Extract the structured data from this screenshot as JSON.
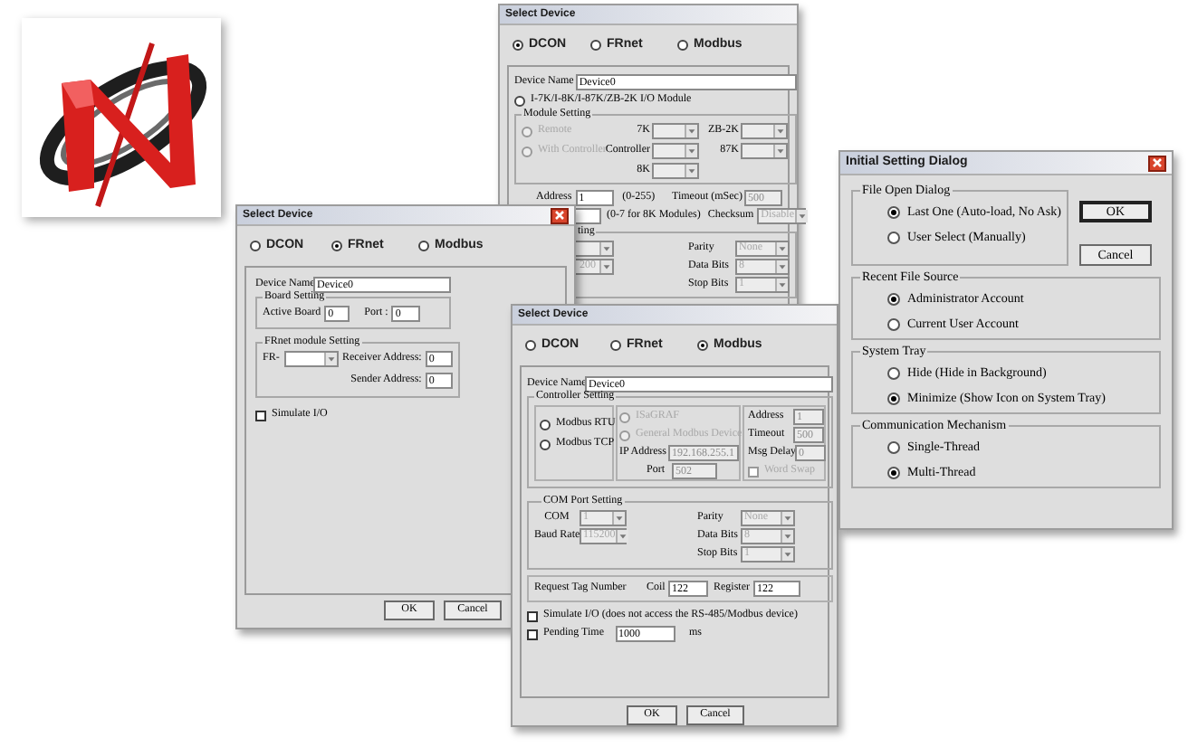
{
  "dcon_dialog": {
    "title": "Select Device",
    "tabs": [
      {
        "label": "DCON",
        "selected": true
      },
      {
        "label": "FRnet",
        "selected": false
      },
      {
        "label": "Modbus",
        "selected": false
      }
    ],
    "device_name": {
      "label": "Device Name",
      "value": "Device0"
    },
    "module_radio": {
      "label": "I-7K/I-8K/I-87K/ZB-2K I/O Module",
      "selected": false
    },
    "module_setting": {
      "title": "Module Setting",
      "modes": [
        {
          "label": "Remote",
          "selected": false,
          "disabled": true
        },
        {
          "label": "With Controller",
          "selected": false,
          "disabled": true
        }
      ],
      "combos": [
        {
          "label": "7K"
        },
        {
          "label": "ZB-2K"
        },
        {
          "label": "Controller"
        },
        {
          "label": "87K"
        },
        {
          "label": "8K"
        }
      ]
    },
    "address": {
      "label": "Address",
      "value": "1",
      "range": "(0-255)"
    },
    "timeout": {
      "label": "Timeout (mSec)",
      "value": "500",
      "disabled": true
    },
    "module_note": "(0-7 for 8K Modules)",
    "checksum": {
      "label": "Checksum",
      "value": "Disable",
      "disabled": true
    },
    "com_port": {
      "title": "ting",
      "baud_value": "200",
      "fields": [
        {
          "label": "Parity",
          "value": "None",
          "disabled": true
        },
        {
          "label": "Data Bits",
          "value": "8",
          "disabled": true
        },
        {
          "label": "Stop Bits",
          "value": "1",
          "disabled": true
        }
      ]
    }
  },
  "frnet_dialog": {
    "title": "Select Device",
    "tabs": [
      {
        "label": "DCON",
        "selected": false
      },
      {
        "label": "FRnet",
        "selected": true
      },
      {
        "label": "Modbus",
        "selected": false
      }
    ],
    "device_name": {
      "label": "Device Name",
      "value": "Device0"
    },
    "board_setting": {
      "title": "Board Setting",
      "active_board": {
        "label": "Active Board",
        "value": "0"
      },
      "port": {
        "label": "Port :",
        "value": "0"
      }
    },
    "module_setting": {
      "title": "FRnet module Setting",
      "fr_label": "FR-",
      "receiver": {
        "label": "Receiver Address:",
        "value": "0"
      },
      "sender": {
        "label": "Sender Address:",
        "value": "0"
      }
    },
    "simulate": {
      "label": "Simulate I/O",
      "checked": false
    },
    "buttons": [
      {
        "label": "OK"
      },
      {
        "label": "Cancel"
      }
    ]
  },
  "modbus_dialog": {
    "title": "Select Device",
    "tabs": [
      {
        "label": "DCON",
        "selected": false
      },
      {
        "label": "FRnet",
        "selected": false
      },
      {
        "label": "Modbus",
        "selected": true
      }
    ],
    "device_name": {
      "label": "Device Name",
      "value": "Device0"
    },
    "controller_setting": {
      "title": "Controller Setting",
      "protocols": [
        {
          "label": "Modbus RTU",
          "selected": false
        },
        {
          "label": "Modbus TCP",
          "selected": false
        }
      ],
      "targets": [
        {
          "label": "ISaGRAF",
          "selected": false,
          "disabled": true
        },
        {
          "label": "General Modbus Device",
          "selected": false,
          "disabled": true
        }
      ],
      "ip_address": {
        "label": "IP Address",
        "value": "192.168.255.1",
        "disabled": true
      },
      "port": {
        "label": "Port",
        "value": "502",
        "disabled": true
      },
      "fields": [
        {
          "label": "Address",
          "value": "1",
          "disabled": true
        },
        {
          "label": "Timeout",
          "value": "500",
          "disabled": true
        },
        {
          "label": "Msg Delay",
          "value": "0",
          "disabled": true
        }
      ],
      "word_swap": {
        "label": "Word Swap",
        "checked": false,
        "disabled": true
      }
    },
    "com_port": {
      "title": "COM Port Setting",
      "left": [
        {
          "label": "COM",
          "value": "1",
          "disabled": true
        },
        {
          "label": "Baud Rate",
          "value": "115200",
          "disabled": true
        }
      ],
      "right": [
        {
          "label": "Parity",
          "value": "None",
          "disabled": true
        },
        {
          "label": "Data Bits",
          "value": "8",
          "disabled": true
        },
        {
          "label": "Stop Bits",
          "value": "1",
          "disabled": true
        }
      ]
    },
    "request_tag": {
      "label": "Request Tag Number",
      "coil": {
        "label": "Coil",
        "value": "122"
      },
      "register": {
        "label": "Register",
        "value": "122"
      }
    },
    "simulate": {
      "label": "Simulate I/O (does not access the RS-485/Modbus device)",
      "checked": false
    },
    "pending": {
      "label": "Pending Time",
      "checked": false,
      "value": "1000",
      "unit": "ms"
    },
    "buttons": [
      {
        "label": "OK"
      },
      {
        "label": "Cancel"
      }
    ]
  },
  "initial_setting_dialog": {
    "title": "Initial Setting Dialog",
    "groups": [
      {
        "title": "File Open Dialog",
        "options": [
          {
            "label": "Last One (Auto-load, No Ask)",
            "selected": true
          },
          {
            "label": "User Select (Manually)",
            "selected": false
          }
        ]
      },
      {
        "title": "Recent File Source",
        "options": [
          {
            "label": "Administrator Account",
            "selected": true
          },
          {
            "label": "Current User Account",
            "selected": false
          }
        ]
      },
      {
        "title": "System Tray",
        "options": [
          {
            "label": "Hide (Hide in Background)",
            "selected": false
          },
          {
            "label": "Minimize (Show Icon on System Tray)",
            "selected": true
          }
        ]
      },
      {
        "title": "Communication Mechanism",
        "options": [
          {
            "label": "Single-Thread",
            "selected": false
          },
          {
            "label": "Multi-Thread",
            "selected": true
          }
        ]
      }
    ],
    "buttons": [
      {
        "label": "OK",
        "default": true
      },
      {
        "label": "Cancel",
        "default": false
      }
    ]
  }
}
